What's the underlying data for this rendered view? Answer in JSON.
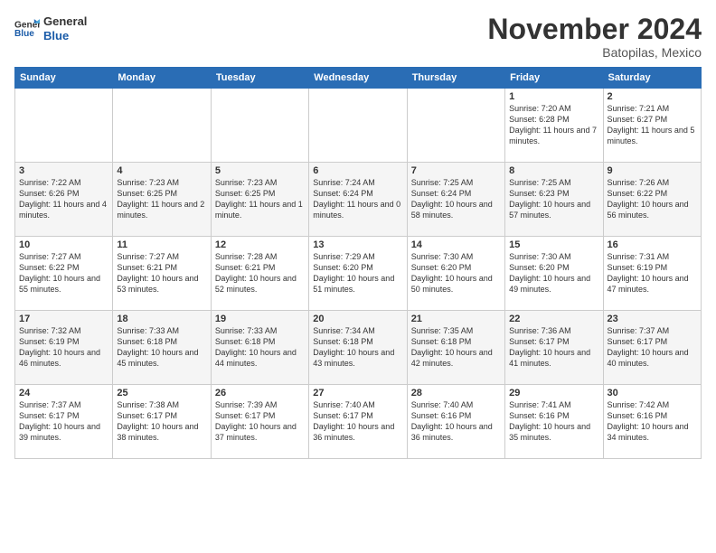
{
  "header": {
    "logo_general": "General",
    "logo_blue": "Blue",
    "month_title": "November 2024",
    "location": "Batopilas, Mexico"
  },
  "weekdays": [
    "Sunday",
    "Monday",
    "Tuesday",
    "Wednesday",
    "Thursday",
    "Friday",
    "Saturday"
  ],
  "weeks": [
    [
      {
        "day": "",
        "info": ""
      },
      {
        "day": "",
        "info": ""
      },
      {
        "day": "",
        "info": ""
      },
      {
        "day": "",
        "info": ""
      },
      {
        "day": "",
        "info": ""
      },
      {
        "day": "1",
        "info": "Sunrise: 7:20 AM\nSunset: 6:28 PM\nDaylight: 11 hours and 7 minutes."
      },
      {
        "day": "2",
        "info": "Sunrise: 7:21 AM\nSunset: 6:27 PM\nDaylight: 11 hours and 5 minutes."
      }
    ],
    [
      {
        "day": "3",
        "info": "Sunrise: 7:22 AM\nSunset: 6:26 PM\nDaylight: 11 hours and 4 minutes."
      },
      {
        "day": "4",
        "info": "Sunrise: 7:23 AM\nSunset: 6:25 PM\nDaylight: 11 hours and 2 minutes."
      },
      {
        "day": "5",
        "info": "Sunrise: 7:23 AM\nSunset: 6:25 PM\nDaylight: 11 hours and 1 minute."
      },
      {
        "day": "6",
        "info": "Sunrise: 7:24 AM\nSunset: 6:24 PM\nDaylight: 11 hours and 0 minutes."
      },
      {
        "day": "7",
        "info": "Sunrise: 7:25 AM\nSunset: 6:24 PM\nDaylight: 10 hours and 58 minutes."
      },
      {
        "day": "8",
        "info": "Sunrise: 7:25 AM\nSunset: 6:23 PM\nDaylight: 10 hours and 57 minutes."
      },
      {
        "day": "9",
        "info": "Sunrise: 7:26 AM\nSunset: 6:22 PM\nDaylight: 10 hours and 56 minutes."
      }
    ],
    [
      {
        "day": "10",
        "info": "Sunrise: 7:27 AM\nSunset: 6:22 PM\nDaylight: 10 hours and 55 minutes."
      },
      {
        "day": "11",
        "info": "Sunrise: 7:27 AM\nSunset: 6:21 PM\nDaylight: 10 hours and 53 minutes."
      },
      {
        "day": "12",
        "info": "Sunrise: 7:28 AM\nSunset: 6:21 PM\nDaylight: 10 hours and 52 minutes."
      },
      {
        "day": "13",
        "info": "Sunrise: 7:29 AM\nSunset: 6:20 PM\nDaylight: 10 hours and 51 minutes."
      },
      {
        "day": "14",
        "info": "Sunrise: 7:30 AM\nSunset: 6:20 PM\nDaylight: 10 hours and 50 minutes."
      },
      {
        "day": "15",
        "info": "Sunrise: 7:30 AM\nSunset: 6:20 PM\nDaylight: 10 hours and 49 minutes."
      },
      {
        "day": "16",
        "info": "Sunrise: 7:31 AM\nSunset: 6:19 PM\nDaylight: 10 hours and 47 minutes."
      }
    ],
    [
      {
        "day": "17",
        "info": "Sunrise: 7:32 AM\nSunset: 6:19 PM\nDaylight: 10 hours and 46 minutes."
      },
      {
        "day": "18",
        "info": "Sunrise: 7:33 AM\nSunset: 6:18 PM\nDaylight: 10 hours and 45 minutes."
      },
      {
        "day": "19",
        "info": "Sunrise: 7:33 AM\nSunset: 6:18 PM\nDaylight: 10 hours and 44 minutes."
      },
      {
        "day": "20",
        "info": "Sunrise: 7:34 AM\nSunset: 6:18 PM\nDaylight: 10 hours and 43 minutes."
      },
      {
        "day": "21",
        "info": "Sunrise: 7:35 AM\nSunset: 6:18 PM\nDaylight: 10 hours and 42 minutes."
      },
      {
        "day": "22",
        "info": "Sunrise: 7:36 AM\nSunset: 6:17 PM\nDaylight: 10 hours and 41 minutes."
      },
      {
        "day": "23",
        "info": "Sunrise: 7:37 AM\nSunset: 6:17 PM\nDaylight: 10 hours and 40 minutes."
      }
    ],
    [
      {
        "day": "24",
        "info": "Sunrise: 7:37 AM\nSunset: 6:17 PM\nDaylight: 10 hours and 39 minutes."
      },
      {
        "day": "25",
        "info": "Sunrise: 7:38 AM\nSunset: 6:17 PM\nDaylight: 10 hours and 38 minutes."
      },
      {
        "day": "26",
        "info": "Sunrise: 7:39 AM\nSunset: 6:17 PM\nDaylight: 10 hours and 37 minutes."
      },
      {
        "day": "27",
        "info": "Sunrise: 7:40 AM\nSunset: 6:17 PM\nDaylight: 10 hours and 36 minutes."
      },
      {
        "day": "28",
        "info": "Sunrise: 7:40 AM\nSunset: 6:16 PM\nDaylight: 10 hours and 36 minutes."
      },
      {
        "day": "29",
        "info": "Sunrise: 7:41 AM\nSunset: 6:16 PM\nDaylight: 10 hours and 35 minutes."
      },
      {
        "day": "30",
        "info": "Sunrise: 7:42 AM\nSunset: 6:16 PM\nDaylight: 10 hours and 34 minutes."
      }
    ]
  ]
}
